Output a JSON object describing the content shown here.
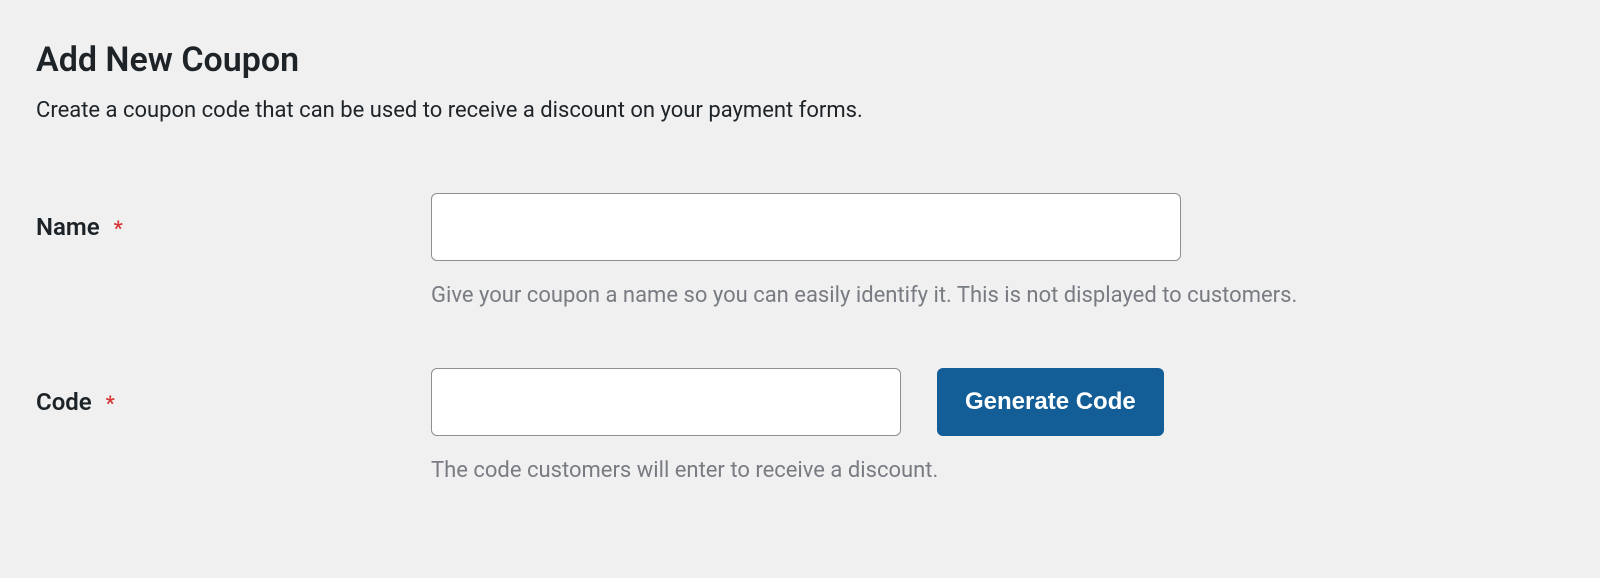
{
  "header": {
    "title": "Add New Coupon",
    "subtitle": "Create a coupon code that can be used to receive a discount on your payment forms."
  },
  "fields": {
    "name": {
      "label": "Name",
      "required_mark": "*",
      "value": "",
      "help": "Give your coupon a name so you can easily identify it. This is not displayed to customers."
    },
    "code": {
      "label": "Code",
      "required_mark": "*",
      "value": "",
      "help": "The code customers will enter to receive a discount.",
      "generate_button": "Generate Code"
    }
  }
}
